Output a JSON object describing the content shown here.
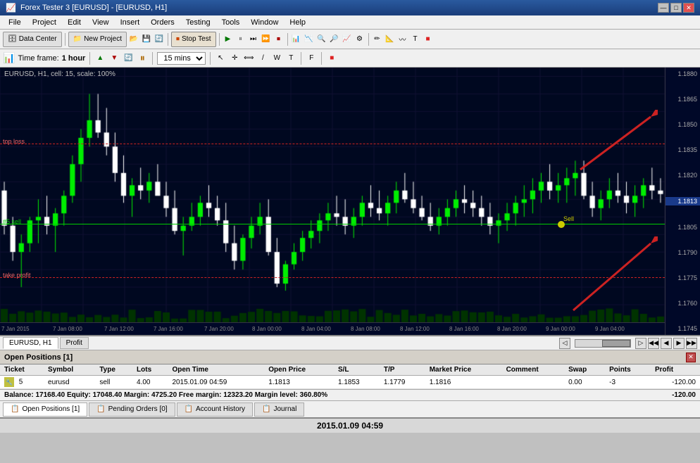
{
  "titleBar": {
    "title": "Forex Tester 3  [EURUSD] - [EURUSD, H1]",
    "controls": [
      "—",
      "□",
      "✕"
    ]
  },
  "menuBar": {
    "items": [
      "File",
      "Project",
      "Edit",
      "View",
      "Insert",
      "Orders",
      "Testing",
      "Tools",
      "Window",
      "Help"
    ]
  },
  "toolbar1": {
    "dataCenter": "Data Center",
    "newProject": "New Project",
    "stopTest": "Stop Test"
  },
  "toolbar2": {
    "timeframeLabel": "Time frame:",
    "timeframeValue": "1 hour",
    "intervalValue": "15 mins"
  },
  "chart": {
    "infoLabel": "EURUSD, H1, cell: 15, scale: 100%",
    "stopLossLabel": "top loss",
    "takeProfitLabel": "take profit",
    "sellLineLabel": "#5 sell",
    "sellMarkerLabel": "Sell",
    "prices": [
      "1.1880",
      "1.1865",
      "1.1850",
      "1.1835",
      "1.1820",
      "1.1813",
      "1.1805",
      "1.1790",
      "1.1775",
      "1.1760",
      "1.1745"
    ],
    "currentPrice": "1.1813",
    "timeLabels": [
      "7 Jan 2015",
      "7 Jan 08:00",
      "7 Jan 12:00",
      "7 Jan 16:00",
      "7 Jan 20:00",
      "8 Jan 00:00",
      "8 Jan 04:00",
      "8 Jan 08:00",
      "8 Jan 12:00",
      "8 Jan 16:00",
      "8 Jan 20:00",
      "9 Jan 00:00",
      "9 Jan 04:00"
    ]
  },
  "chartTabs": {
    "tabs": [
      "EURUSD, H1",
      "Profit"
    ],
    "activeTab": "EURUSD, H1"
  },
  "openPositions": {
    "title": "Open Positions [1]",
    "columns": [
      "Ticket",
      "Symbol",
      "Type",
      "Lots",
      "Open Time",
      "Open Price",
      "S/L",
      "T/P",
      "Market Price",
      "Comment",
      "Swap",
      "Points",
      "Profit"
    ],
    "rows": [
      {
        "ticket": "5",
        "symbol": "eurusd",
        "type": "sell",
        "lots": "4.00",
        "openTime": "2015.01.09 04:59",
        "openPrice": "1.1813",
        "sl": "1.1853",
        "tp": "1.1779",
        "marketPrice": "1.1816",
        "comment": "",
        "swap": "0.00",
        "points": "-3",
        "profit": "-120.00"
      }
    ]
  },
  "balanceBar": {
    "text": "Balance: 17168.40  Equity: 17048.40  Margin: 4725.20  Free margin: 12323.20  Margin level: 360.80%",
    "profit": "-120.00"
  },
  "bottomTabs": {
    "tabs": [
      "Open Positions [1]",
      "Pending Orders [0]",
      "Account History",
      "Journal"
    ],
    "activeTab": "Open Positions [1]"
  },
  "dateFooter": {
    "date": "2015.01.09 04:59"
  }
}
